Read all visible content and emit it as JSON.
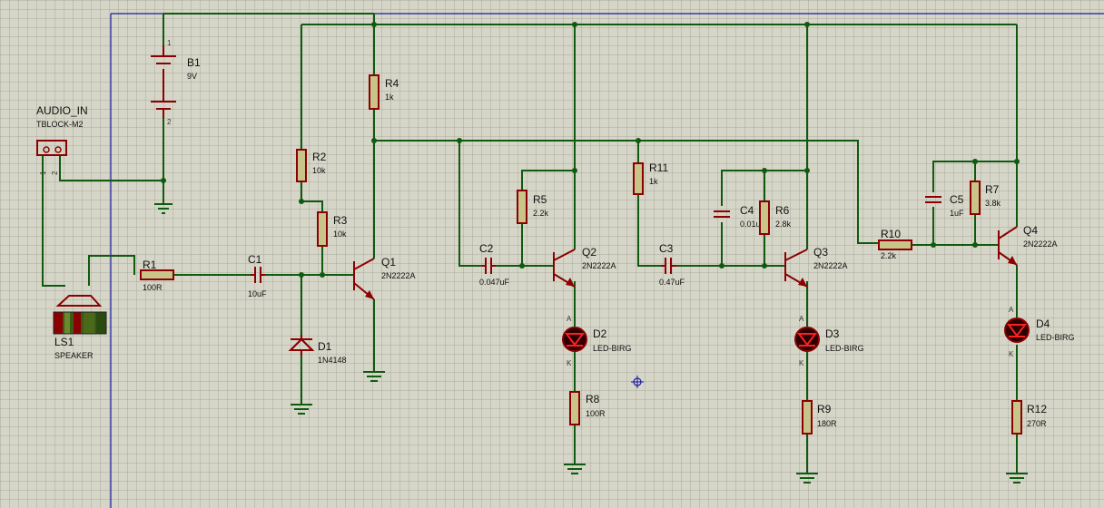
{
  "colors": {
    "wire": "#0f5a0f",
    "component": "#8b0000",
    "body": "#c9c48a",
    "background": "#d6d6c8",
    "frame": "#1a1aa0"
  },
  "parts": {
    "b1": {
      "ref": "B1",
      "value": "9V"
    },
    "audio": {
      "ref": "AUDIO_IN",
      "value": "TBLOCK-M2"
    },
    "ls1": {
      "ref": "LS1",
      "value": "SPEAKER"
    },
    "r1": {
      "ref": "R1",
      "value": "100R"
    },
    "c1": {
      "ref": "C1",
      "value": "10uF"
    },
    "r2": {
      "ref": "R2",
      "value": "10k"
    },
    "r3": {
      "ref": "R3",
      "value": "10k"
    },
    "r4": {
      "ref": "R4",
      "value": "1k"
    },
    "q1": {
      "ref": "Q1",
      "value": "2N2222A"
    },
    "d1": {
      "ref": "D1",
      "value": "1N4148"
    },
    "c2": {
      "ref": "C2",
      "value": "0.047uF"
    },
    "r5": {
      "ref": "R5",
      "value": "2.2k"
    },
    "q2": {
      "ref": "Q2",
      "value": "2N2222A"
    },
    "d2": {
      "ref": "D2",
      "value": "LED-BIRG"
    },
    "r8": {
      "ref": "R8",
      "value": "100R"
    },
    "r11": {
      "ref": "R11",
      "value": "1k"
    },
    "c3": {
      "ref": "C3",
      "value": "0.47uF"
    },
    "c4": {
      "ref": "C4",
      "value": "0.01u"
    },
    "r6": {
      "ref": "R6",
      "value": "2.8k"
    },
    "q3": {
      "ref": "Q3",
      "value": "2N2222A"
    },
    "d3": {
      "ref": "D3",
      "value": "LED-BIRG"
    },
    "r9": {
      "ref": "R9",
      "value": "180R"
    },
    "r10": {
      "ref": "R10",
      "value": "2.2k"
    },
    "c5": {
      "ref": "C5",
      "value": "1uF"
    },
    "r7": {
      "ref": "R7",
      "value": "3.8k"
    },
    "q4": {
      "ref": "Q4",
      "value": "2N2222A"
    },
    "d4": {
      "ref": "D4",
      "value": "LED-BIRG"
    },
    "r12": {
      "ref": "R12",
      "value": "270R"
    }
  },
  "pins": {
    "one": "1",
    "two": "2",
    "anode": "A",
    "cathode": "K"
  }
}
